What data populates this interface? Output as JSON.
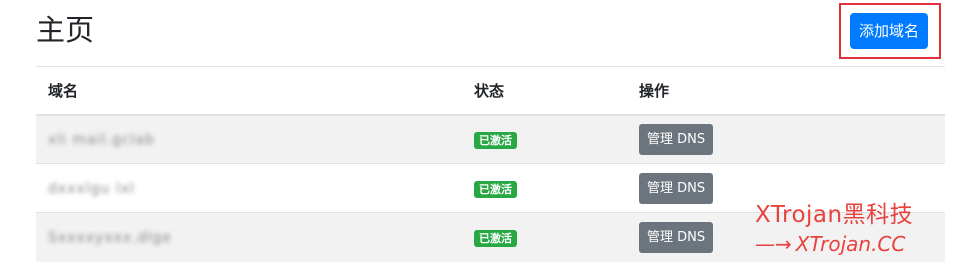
{
  "header": {
    "title": "主页",
    "add_button_label": "添加域名"
  },
  "table": {
    "columns": [
      "域名",
      "状态",
      "操作"
    ],
    "rows": [
      {
        "domain": "xli mail.gclab",
        "status": "已激活",
        "action": "管理 DNS"
      },
      {
        "domain": "dxxxlgu lxl",
        "status": "已激活",
        "action": "管理 DNS"
      },
      {
        "domain": "Sxxxxyxxx.dlge",
        "status": "已激活",
        "action": "管理 DNS"
      }
    ]
  },
  "watermark": {
    "line1": "XTrojan黑科技",
    "arrow": "—→",
    "line2": "XTrojan.CC"
  },
  "colors": {
    "primary": "#007bff",
    "success": "#28a745",
    "secondary": "#6c757d",
    "highlight_border": "#e0303a",
    "watermark": "#e8423f"
  }
}
